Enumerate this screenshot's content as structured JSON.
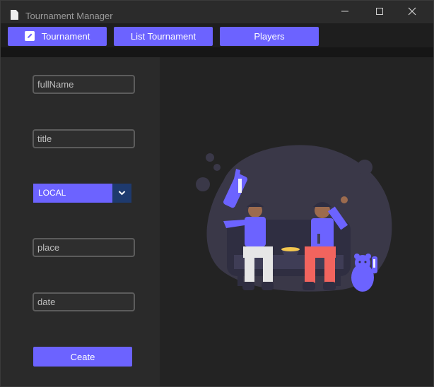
{
  "window": {
    "title": "Tournament Manager"
  },
  "nav": {
    "tournament": "Tournament",
    "list_tournament": "List Tournament",
    "players": "Players"
  },
  "form": {
    "fullname_placeholder": "fullName",
    "title_placeholder": "title",
    "type_value": "LOCAL",
    "place_placeholder": "place",
    "date_placeholder": "date",
    "create_label": "Ceate"
  },
  "colors": {
    "accent": "#6c63ff",
    "dropdown_arrow_bg": "#1e3a6e",
    "sidebar_bg": "#2a2a2a",
    "main_bg": "#232323"
  },
  "icons": {
    "app": "document-icon",
    "nav_tournament": "pencil-icon",
    "minimize": "minimize-icon",
    "maximize": "maximize-icon",
    "close": "close-icon",
    "dropdown": "chevron-down-icon"
  }
}
